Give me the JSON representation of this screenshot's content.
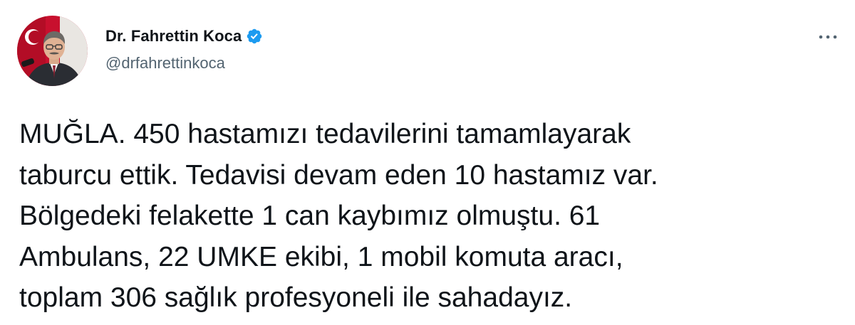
{
  "author": {
    "display_name": "Dr. Fahrettin Koca",
    "handle": "@drfahrettinkoca",
    "verified": true,
    "avatar_icon": "profile-photo"
  },
  "menu_icon": "more-horizontal-icon",
  "colors": {
    "verified_badge": "#1d9bf0",
    "text_primary": "#0f1419",
    "text_secondary": "#536471"
  },
  "tweet": {
    "lines": [
      "MUĞLA. 450 hastamızı tedavilerini tamamlayarak",
      "taburcu ettik. Tedavisi devam eden 10 hastamız var.",
      "Bölgedeki felakette 1 can kaybımız olmuştu. 61",
      "Ambulans, 22 UMKE ekibi, 1 mobil komuta aracı,",
      "toplam 306 sağlık profesyoneli ile sahadayız."
    ]
  }
}
